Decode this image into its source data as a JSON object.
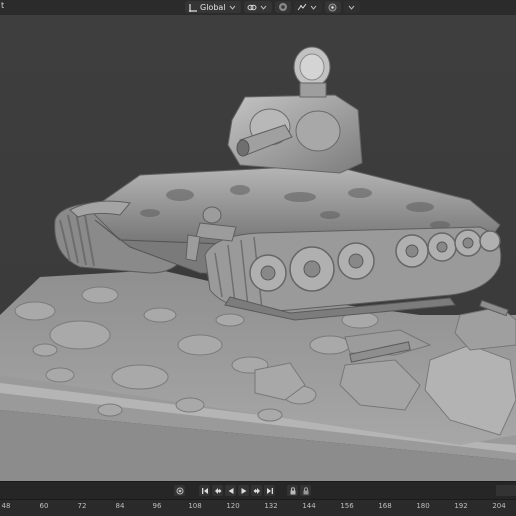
{
  "header": {
    "left_fragment": "t",
    "orientation": {
      "label": "Global",
      "icon": "transform-orientation-icon"
    },
    "pivot_icon": "link-icon",
    "snap_icon": "snap-magnet-icon",
    "proportional_icon": "proportional-edit-icon",
    "overlay_icon": "dot-circle-icon"
  },
  "playback": {
    "controls": [
      "record-icon",
      "jump-start-icon",
      "prev-keyframe-icon",
      "play-reverse-icon",
      "play-icon",
      "next-keyframe-icon",
      "jump-end-icon",
      "lock-icon",
      "keying-set-icon"
    ]
  },
  "timeline": {
    "ticks": [
      "48",
      "60",
      "72",
      "84",
      "96",
      "108",
      "120",
      "132",
      "144",
      "156",
      "168",
      "180",
      "192",
      "204"
    ]
  },
  "viewport": {
    "description_icon": "3d-model-icon"
  }
}
